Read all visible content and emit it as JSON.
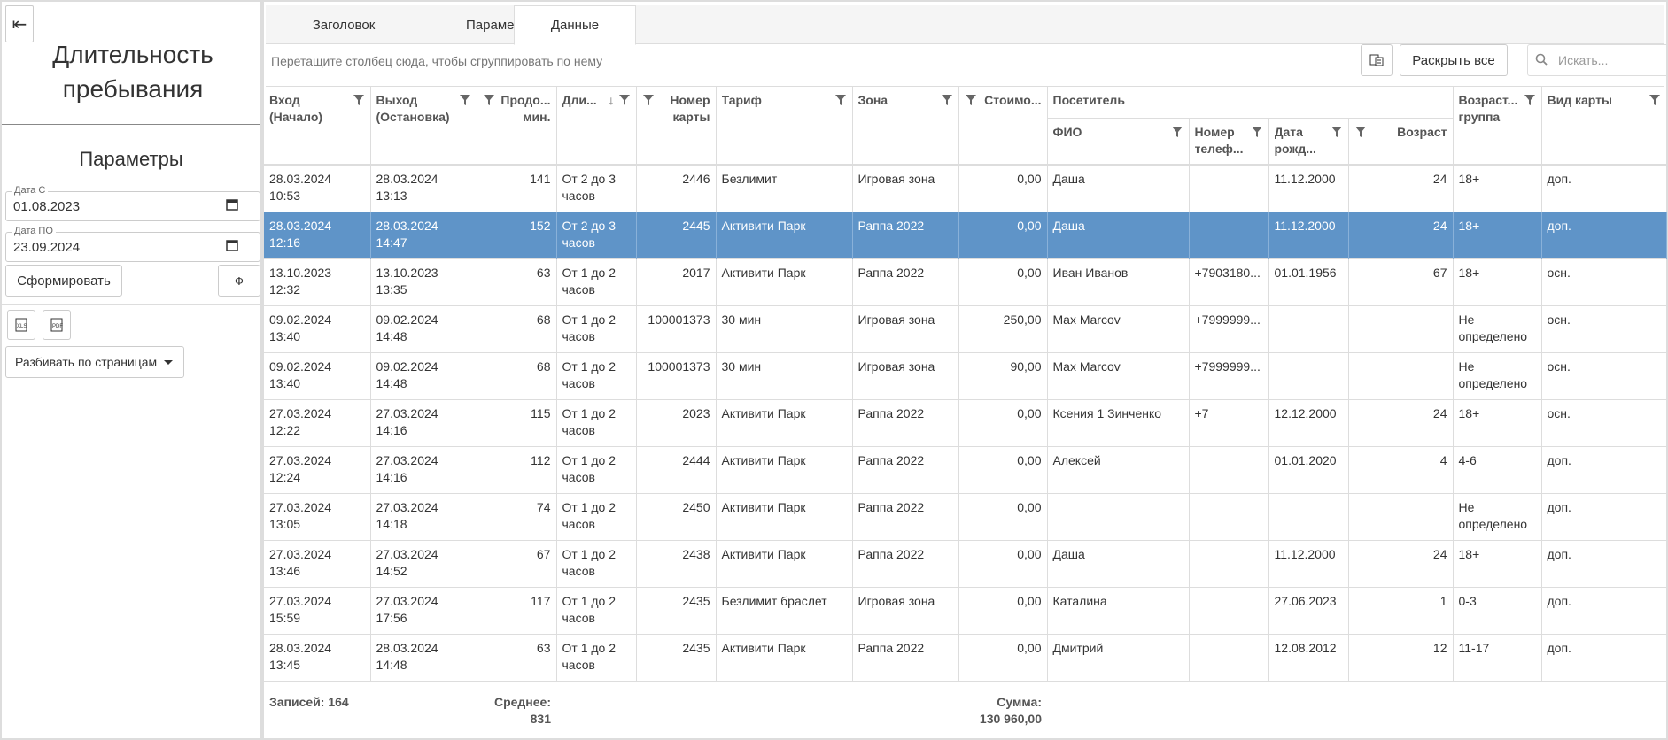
{
  "left": {
    "title": "Длительность пребывания",
    "params_title": "Параметры",
    "date_from": {
      "label": "Дата С",
      "value": "01.08.2023"
    },
    "date_to": {
      "label": "Дата ПО",
      "value": "23.09.2024"
    },
    "form_button": "Сформировать",
    "filter_button": "Ф",
    "paging_select": "Разбивать по страницам"
  },
  "tabs": [
    "Заголовок",
    "Параметры",
    "Данные"
  ],
  "toolbar": {
    "group_hint": "Перетащите столбец сюда, чтобы сгруппировать по нему",
    "expand_all": "Раскрыть все",
    "search_placeholder": "Искать..."
  },
  "columns": {
    "entry": "Вход (Начало)",
    "exit": "Выход (Остановка)",
    "duration_min": "Продо... мин.",
    "duration": "Дли...",
    "card_no": "Номер карты",
    "tariff": "Тариф",
    "zone": "Зона",
    "cost": "Стоимо...",
    "visitor": "Посетитель",
    "fio": "ФИО",
    "phone": "Номер телеф...",
    "birth": "Дата рожд...",
    "age": "Возраст",
    "age_group": "Возраст... группа",
    "card_type": "Вид карты"
  },
  "rows": [
    {
      "entry": "28.03.2024 10:53",
      "exit": "28.03.2024 13:13",
      "minutes": "141",
      "duration": "От 2 до 3 часов",
      "card": "2446",
      "tariff": "Безлимит",
      "zone": "Игровая зона",
      "cost": "0,00",
      "fio": "Даша",
      "phone": "",
      "birth": "11.12.2000",
      "age": "24",
      "group": "18+",
      "type": "доп."
    },
    {
      "entry": "28.03.2024 12:16",
      "exit": "28.03.2024 14:47",
      "minutes": "152",
      "duration": "От 2 до 3 часов",
      "card": "2445",
      "tariff": "Активити Парк",
      "zone": "Раппа 2022",
      "cost": "0,00",
      "fio": "Даша",
      "phone": "",
      "birth": "11.12.2000",
      "age": "24",
      "group": "18+",
      "type": "доп."
    },
    {
      "entry": "13.10.2023 12:32",
      "exit": "13.10.2023 13:35",
      "minutes": "63",
      "duration": "От 1 до 2 часов",
      "card": "2017",
      "tariff": "Активити Парк",
      "zone": "Раппа 2022",
      "cost": "0,00",
      "fio": "Иван Иванов",
      "phone": "+7903180...",
      "birth": "01.01.1956",
      "age": "67",
      "group": "18+",
      "type": "осн."
    },
    {
      "entry": "09.02.2024 13:40",
      "exit": "09.02.2024 14:48",
      "minutes": "68",
      "duration": "От 1 до 2 часов",
      "card": "100001373",
      "tariff": "30 мин",
      "zone": "Игровая зона",
      "cost": "250,00",
      "fio": "Max Marcov",
      "phone": "+7999999...",
      "birth": "",
      "age": "",
      "group": "Не определено",
      "type": "осн."
    },
    {
      "entry": "09.02.2024 13:40",
      "exit": "09.02.2024 14:48",
      "minutes": "68",
      "duration": "От 1 до 2 часов",
      "card": "100001373",
      "tariff": "30 мин",
      "zone": "Игровая зона",
      "cost": "90,00",
      "fio": "Max Marcov",
      "phone": "+7999999...",
      "birth": "",
      "age": "",
      "group": "Не определено",
      "type": "осн."
    },
    {
      "entry": "27.03.2024 12:22",
      "exit": "27.03.2024 14:16",
      "minutes": "115",
      "duration": "От 1 до 2 часов",
      "card": "2023",
      "tariff": "Активити Парк",
      "zone": "Раппа 2022",
      "cost": "0,00",
      "fio": "Ксения 1 Зинченко",
      "phone": "+7",
      "birth": "12.12.2000",
      "age": "24",
      "group": "18+",
      "type": "осн."
    },
    {
      "entry": "27.03.2024 12:24",
      "exit": "27.03.2024 14:16",
      "minutes": "112",
      "duration": "От 1 до 2 часов",
      "card": "2444",
      "tariff": "Активити Парк",
      "zone": "Раппа 2022",
      "cost": "0,00",
      "fio": "Алексей",
      "phone": "",
      "birth": "01.01.2020",
      "age": "4",
      "group": "4-6",
      "type": "доп."
    },
    {
      "entry": "27.03.2024 13:05",
      "exit": "27.03.2024 14:18",
      "minutes": "74",
      "duration": "От 1 до 2 часов",
      "card": "2450",
      "tariff": "Активити Парк",
      "zone": "Раппа 2022",
      "cost": "0,00",
      "fio": "",
      "phone": "",
      "birth": "",
      "age": "",
      "group": "Не определено",
      "type": "доп."
    },
    {
      "entry": "27.03.2024 13:46",
      "exit": "27.03.2024 14:52",
      "minutes": "67",
      "duration": "От 1 до 2 часов",
      "card": "2438",
      "tariff": "Активити Парк",
      "zone": "Раппа 2022",
      "cost": "0,00",
      "fio": "Даша",
      "phone": "",
      "birth": "11.12.2000",
      "age": "24",
      "group": "18+",
      "type": "доп."
    },
    {
      "entry": "27.03.2024 15:59",
      "exit": "27.03.2024 17:56",
      "minutes": "117",
      "duration": "От 1 до 2 часов",
      "card": "2435",
      "tariff": "Безлимит браслет",
      "zone": "Игровая зона",
      "cost": "0,00",
      "fio": "Каталина",
      "phone": "",
      "birth": "27.06.2023",
      "age": "1",
      "group": "0-3",
      "type": "доп."
    },
    {
      "entry": "28.03.2024 13:45",
      "exit": "28.03.2024 14:48",
      "minutes": "63",
      "duration": "От 1 до 2 часов",
      "card": "2435",
      "tariff": "Активити Парк",
      "zone": "Раппа 2022",
      "cost": "0,00",
      "fio": "Дмитрий",
      "phone": "",
      "birth": "12.08.2012",
      "age": "12",
      "group": "11-17",
      "type": "доп."
    }
  ],
  "selected_row": 1,
  "footer": {
    "records": "Записей: 164",
    "average_label": "Среднее:",
    "average_value": "831",
    "sum_label": "Сумма:",
    "sum_value": "130 960,00"
  },
  "colors": {
    "selected_row": "#5f94c8",
    "border": "#dddddd"
  }
}
